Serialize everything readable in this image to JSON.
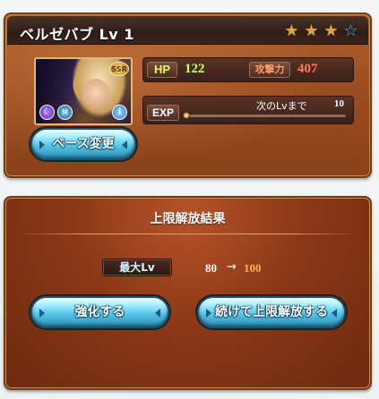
{
  "character": {
    "name_level": "ベルゼバブ Lv 1",
    "rarity": "SSR",
    "stars": {
      "filled": 3,
      "empty": 1
    },
    "hp_label": "HP",
    "hp": "122",
    "atk_label": "攻撃力",
    "atk": "407",
    "exp_label": "EXP",
    "next_lv_label": "次のLvまで",
    "next_lv_value": "10",
    "exp_progress": 0.0
  },
  "icons": {
    "element": "dark-element-icon",
    "skill": "skill-icon",
    "info": "info-icon"
  },
  "buttons": {
    "base_change": "ベース変更",
    "enhance": "強化する",
    "continue_uncap": "続けて上限解放する"
  },
  "result": {
    "title": "上限解放結果",
    "max_lv_label": "最大Lv",
    "max_lv_from": "80",
    "arrow": "→",
    "max_lv_to": "100"
  },
  "colors": {
    "card_brown": "#9b4d22",
    "header_dark": "#2f1d17",
    "hp_green": "#c9ff6d",
    "atk_red": "#ff7a5a",
    "new_value_orange": "#ffb24a",
    "button_blue": "#57c6e8"
  }
}
